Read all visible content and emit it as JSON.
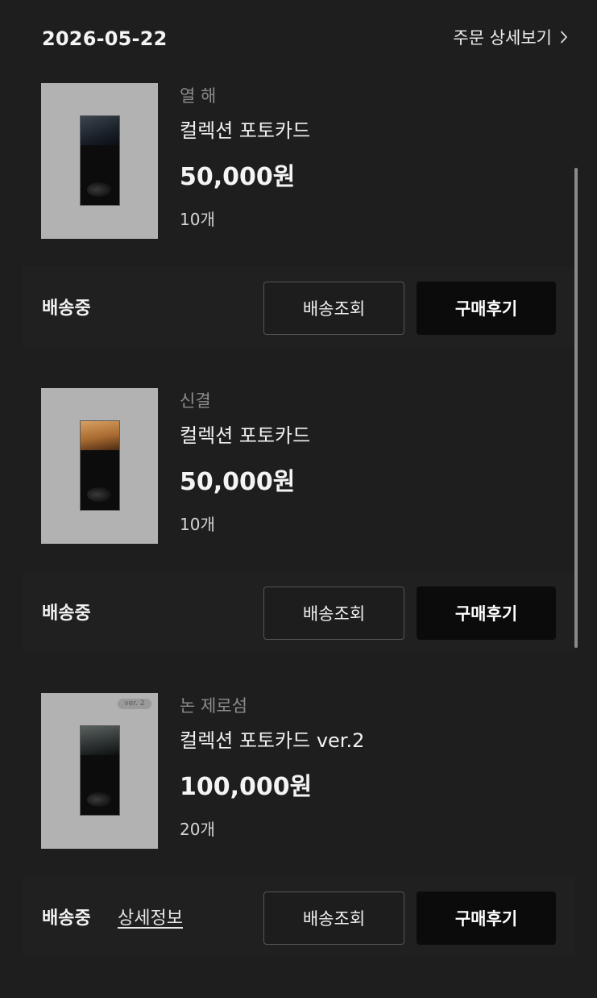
{
  "header": {
    "order_date": "2026-05-22",
    "order_detail_label": "주문 상세보기"
  },
  "items": [
    {
      "artist": "열 해",
      "name": "컬렉션 포토카드",
      "price": "50,000원",
      "quantity": "10개",
      "status": "배송중",
      "track_label": "배송조회",
      "review_label": "구매후기"
    },
    {
      "artist": "신결",
      "name": "컬렉션 포토카드",
      "price": "50,000원",
      "quantity": "10개",
      "status": "배송중",
      "track_label": "배송조회",
      "review_label": "구매후기"
    },
    {
      "artist": "논 제로섬",
      "name": "컬렉션 포토카드 ver.2",
      "price": "100,000원",
      "quantity": "20개",
      "status": "배송중",
      "detail_label": "상세정보",
      "thumbnail_badge": "ver. 2",
      "track_label": "배송조회",
      "review_label": "구매후기"
    }
  ],
  "icons": {
    "order_detail": "chevron-right-icon"
  },
  "colors": {
    "background": "#1e1e1e",
    "review_button": "#0b0b0b",
    "track_button_border": "#555555",
    "artist_text": "#8c8c8c"
  }
}
